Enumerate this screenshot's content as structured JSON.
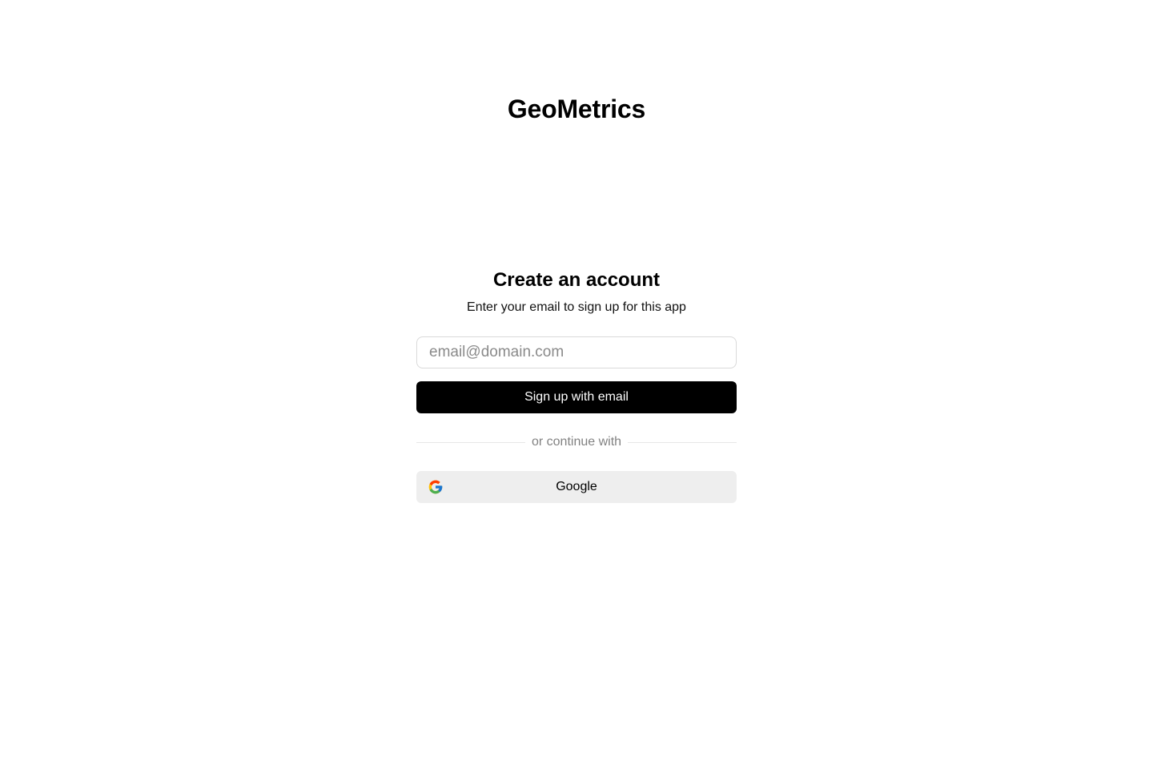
{
  "brand": {
    "name": "GeoMetrics"
  },
  "signup": {
    "heading": "Create an account",
    "subheading": "Enter your email to sign up for this app",
    "email_placeholder": "email@domain.com",
    "email_value": "",
    "submit_label": "Sign up with email",
    "divider_text": "or continue with",
    "google_label": "Google",
    "google_icon": "google-icon"
  },
  "colors": {
    "primary_button_bg": "#000000",
    "primary_button_text": "#ffffff",
    "google_button_bg": "#eeeeee",
    "divider_text": "#828282"
  }
}
